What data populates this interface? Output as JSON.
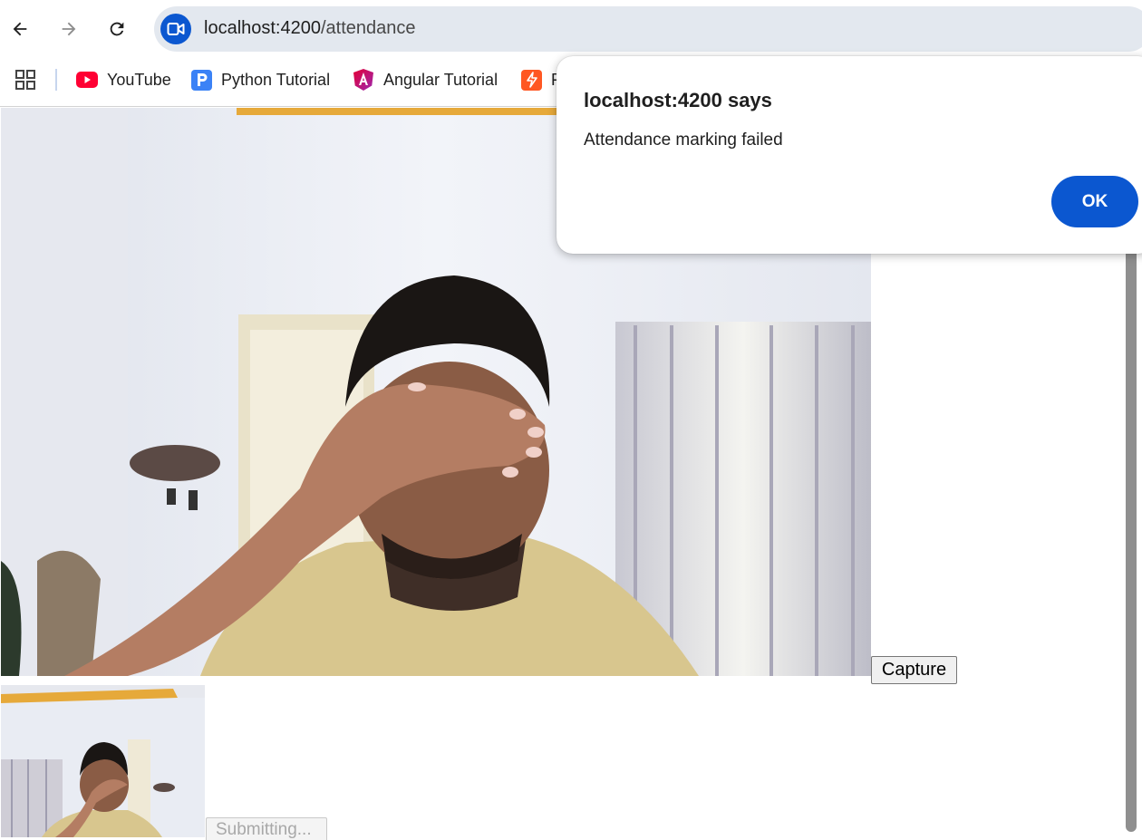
{
  "browser": {
    "url_host": "localhost:4200",
    "url_path": "/attendance",
    "accent_color": "#0b57d0",
    "icons": [
      "back-arrow-icon",
      "forward-arrow-icon",
      "reload-icon",
      "video-camera-icon"
    ]
  },
  "bookmarks": {
    "items": [
      {
        "label": "YouTube",
        "icon": "youtube-icon",
        "color": "#ff0033"
      },
      {
        "label": "Python Tutorial",
        "icon": "p-letter-icon",
        "color": "#3b82f6"
      },
      {
        "label": "Angular Tutorial",
        "icon": "angular-icon",
        "color": "#c3002f"
      },
      {
        "label": "F",
        "icon": "lightning-icon",
        "color": "#ff5722"
      }
    ]
  },
  "page": {
    "capture_label": "Capture",
    "submit_label": "Submitting..."
  },
  "dialog": {
    "title": "localhost:4200 says",
    "message": "Attendance marking failed",
    "ok_label": "OK"
  }
}
